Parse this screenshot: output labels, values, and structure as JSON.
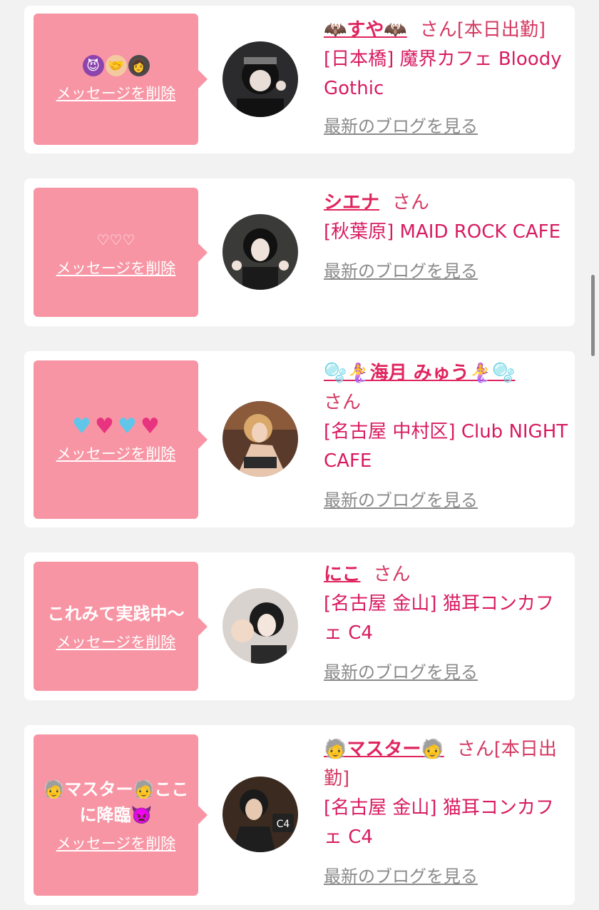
{
  "delete_label": "メッセージを削除",
  "blog_label": "最新のブログを見る",
  "cards": [
    {
      "message": "",
      "message_emojis": [
        "devil-face",
        "handshake",
        "person"
      ],
      "name": "🦇すや🦇",
      "suffix": "さん[本日出勤]",
      "store": "[日本橋] 魔界カフェ Bloody Gothic",
      "avatar_desc": "gothic girl with headpiece"
    },
    {
      "message": "♡♡♡",
      "message_emojis": [],
      "name": "シエナ",
      "suffix": "さん",
      "store": "[秋葉原] MAID ROCK CAFE",
      "avatar_desc": "girl with black hair making horns sign"
    },
    {
      "message": "",
      "message_emojis": [
        "blue-heart",
        "pink-heart",
        "blue-heart",
        "pink-heart"
      ],
      "name": "🫧🧜‍♀️海月 みゅう🧜‍♀️🫧",
      "suffix": "さん",
      "store": "[名古屋 中村区] Club NIGHT CAFE",
      "avatar_desc": "blonde girl sitting"
    },
    {
      "message": "これみて実践中〜",
      "message_emojis": [],
      "name": "にこ",
      "suffix": "さん",
      "store": "[名古屋 金山] 猫耳コンカフェ C4",
      "avatar_desc": "girl with fist toward camera"
    },
    {
      "message": "🧓マスター🧓ここに降臨👿",
      "message_emojis": [],
      "name": "🧓マスター🧓",
      "suffix": "さん[本日出勤]",
      "store": "[名古屋 金山] 猫耳コンカフェ C4",
      "avatar_desc": "man in suit holding C4 sign"
    }
  ],
  "colors": {
    "bubble": "#f895a4",
    "name": "#e0245e",
    "store": "#d81b60",
    "blog": "#8a8a8a",
    "background": "#f2f2f2"
  }
}
